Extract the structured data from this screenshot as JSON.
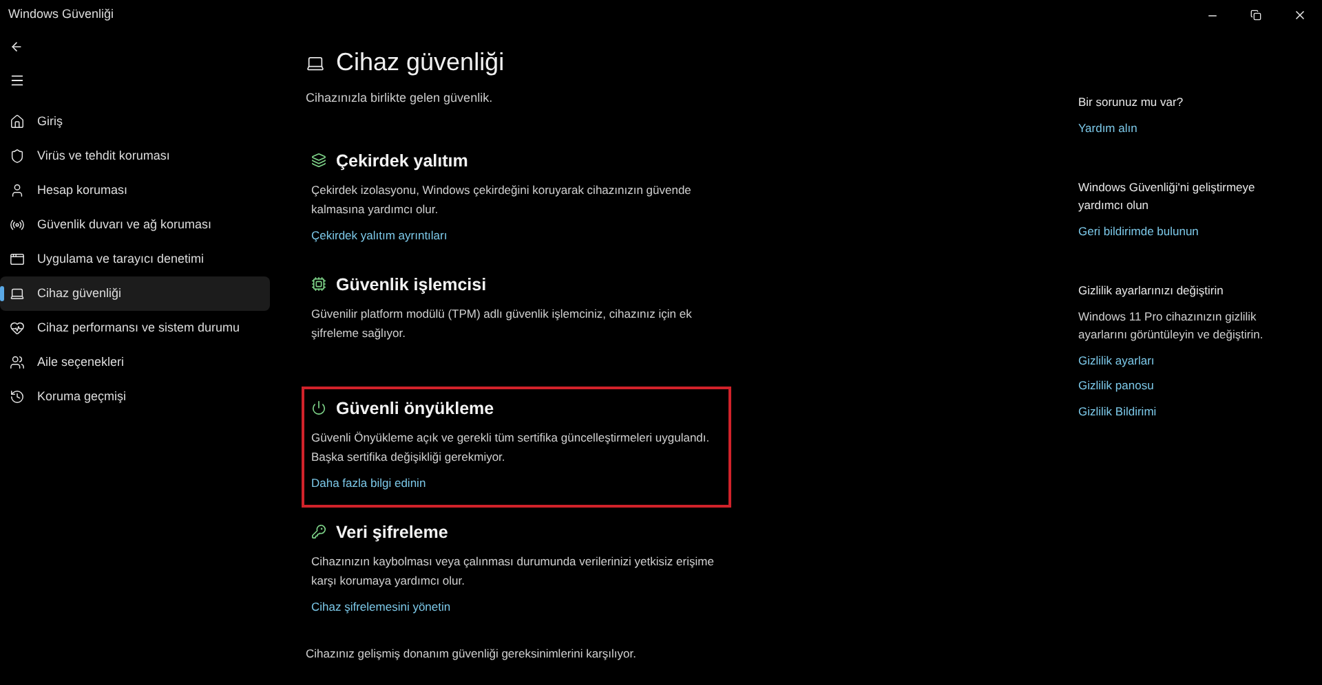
{
  "window": {
    "title": "Windows Güvenliği"
  },
  "sidebar": {
    "items": [
      {
        "kind": "home",
        "label": "Giriş",
        "selected": false
      },
      {
        "kind": "shield",
        "label": "Virüs ve tehdit koruması",
        "selected": false
      },
      {
        "kind": "person",
        "label": "Hesap koruması",
        "selected": false
      },
      {
        "kind": "wifi",
        "label": "Güvenlik duvarı ve ağ koruması",
        "selected": false
      },
      {
        "kind": "browser",
        "label": "Uygulama ve tarayıcı denetimi",
        "selected": false
      },
      {
        "kind": "laptop",
        "label": "Cihaz güvenliği",
        "selected": true
      },
      {
        "kind": "heart",
        "label": "Cihaz performansı ve sistem durumu",
        "selected": false
      },
      {
        "kind": "family",
        "label": "Aile seçenekleri",
        "selected": false
      },
      {
        "kind": "history",
        "label": "Koruma geçmişi",
        "selected": false
      }
    ]
  },
  "page": {
    "title": "Cihaz güvenliği",
    "subtitle": "Cihazınızla birlikte gelen güvenlik.",
    "sections": [
      {
        "kind": "core",
        "title": "Çekirdek yalıtım",
        "description": "Çekirdek izolasyonu, Windows çekirdeğini koruyarak cihazınızın güvende kalmasına yardımcı olur.",
        "link": "Çekirdek yalıtım ayrıntıları",
        "highlighted": false
      },
      {
        "kind": "chip",
        "title": "Güvenlik işlemcisi",
        "description": "Güvenilir platform modülü (TPM) adlı güvenlik işlemciniz, cihazınız için ek şifreleme sağlıyor.",
        "highlighted": false
      },
      {
        "kind": "power",
        "title": "Güvenli önyükleme",
        "description": "Güvenli Önyükleme açık ve gerekli tüm sertifika güncelleştirmeleri uygulandı. Başka sertifika değişikliği gerekmiyor.",
        "link": "Daha fazla bilgi edinin",
        "highlighted": true
      },
      {
        "kind": "encryption",
        "title": "Veri şifreleme",
        "description": "Cihazınızın kaybolması veya çalınması durumunda verilerinizi yetkisiz erişime karşı korumaya yardımcı olur.",
        "link": "Cihaz şifrelemesini yönetin",
        "highlighted": false
      }
    ],
    "footer": "Cihazınız gelişmiş donanım güvenliği gereksinimlerini karşılıyor."
  },
  "side_panel": [
    {
      "heading": "Bir sorunuz mu var?",
      "links": [
        "Yardım alın"
      ]
    },
    {
      "heading": "Windows Güvenliği'ni geliştirmeye yardımcı olun",
      "links": [
        "Geri bildirimde bulunun"
      ]
    },
    {
      "heading": "Gizlilik ayarlarınızı değiştirin",
      "text": "Windows 11 Pro cihazınızın gizlilik ayarlarını görüntüleyin ve değiştirin.",
      "links": [
        "Gizlilik ayarları",
        "Gizlilik panosu",
        "Gizlilik Bildirimi"
      ]
    }
  ]
}
